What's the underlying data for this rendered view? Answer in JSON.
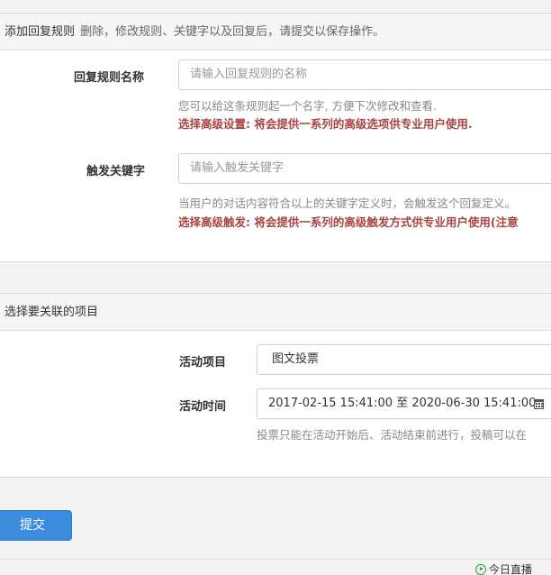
{
  "rule_panel": {
    "title": "添加回复规则",
    "hint": "删除，修改规则、关键字以及回复后，请提交以保存操作。",
    "rule_name": {
      "label": "回复规则名称",
      "placeholder": "请输入回复规则的名称",
      "help": "您可以给这条规则起一个名字, 方便下次修改和查看.",
      "warning": "选择高级设置: 将会提供一系列的高级选项供专业用户使用."
    },
    "keyword": {
      "label": "触发关键字",
      "placeholder": "请输入触发关键字",
      "help": "当用户的对话内容符合以上的关键字定义时，会触发这个回复定义。",
      "warning": "选择高级触发: 将会提供一系列的高级触发方式供专业用户使用(注意"
    }
  },
  "project_panel": {
    "title": "选择要关联的项目",
    "activity": {
      "label": "活动项目",
      "value": "图文投票"
    },
    "time": {
      "label": "活动时间",
      "value": "2017-02-15 15:41:00 至 2020-06-30 15:41:00",
      "icon": "calendar-icon",
      "help": "投票只能在活动开始后、活动结束前进行，投稿可以在"
    }
  },
  "submit_label": "提交",
  "footer": {
    "live_label": "今日直播",
    "live_icon": "play-circle-icon",
    "accent_color": "#2e9e4a"
  },
  "colors": {
    "primary_button": "#3c8dde",
    "warning_text": "#a94442"
  }
}
